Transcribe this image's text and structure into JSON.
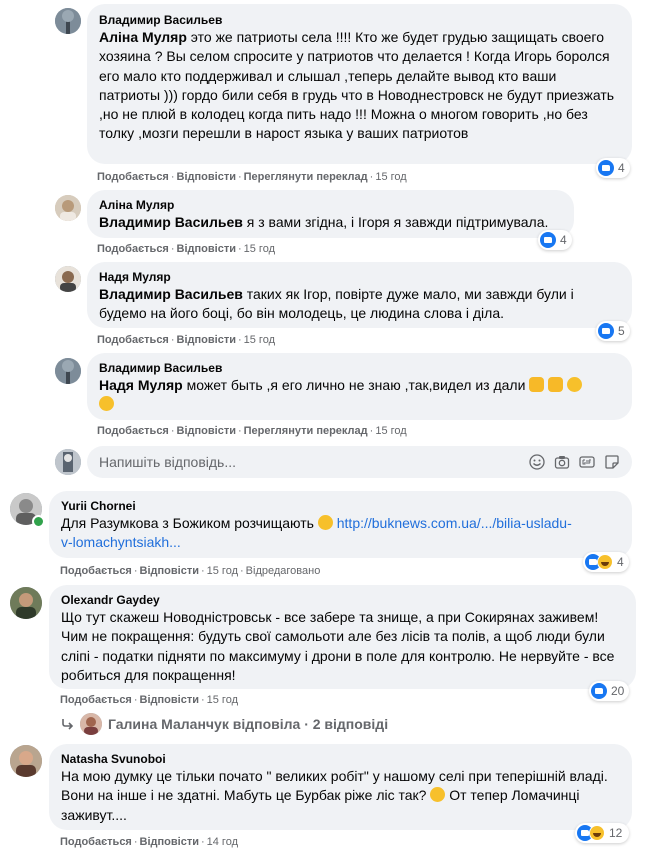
{
  "comments": [
    {
      "author": "Владимир Васильев",
      "mention": "Аліна Муляр",
      "text": " это же патриоты села !!!! Кто же будет грудью защищать своего хозяина ? Вы селом спросите у патриотов что делается ! Когда Игорь боролся его мало кто поддерживал и слышал ,теперь делайте вывод кто ваши патриоты ))) гордо били себя в грудь что в Новоднестровск не будут приезжать ,но не плюй в колодец когда пить надо !!! Можна о многом говорить ,но без толку ,мозги перешли в нарост языка у ваших патриотов",
      "actions": {
        "like": "Подобається",
        "reply": "Відповісти",
        "translate": "Переглянути переклад",
        "time": "15 год"
      },
      "reactions": "4"
    },
    {
      "author": "Аліна Муляр",
      "mention": "Владимир Васильев",
      "text": " я з вами згідна, і Ігоря я завжди підтримувала.",
      "actions": {
        "like": "Подобається",
        "reply": "Відповісти",
        "time": "15 год"
      },
      "reactions": "4"
    },
    {
      "author": "Надя Муляр",
      "mention": "Владимир Васильев",
      "text": " таких як Ігор, повірте дуже мало, ми завжди були і будемо на його боці, бо він молодець, це людина слова і діла.",
      "actions": {
        "like": "Подобається",
        "reply": "Відповісти",
        "time": "15 год"
      },
      "reactions": "5"
    },
    {
      "author": "Владимир Васильев",
      "mention": "Надя Муляр",
      "text": " может быть ,я его лично не знаю ,так,видел из дали",
      "actions": {
        "like": "Подобається",
        "reply": "Відповісти",
        "translate": "Переглянути переклад",
        "time": "15 год"
      }
    }
  ],
  "reply_box": {
    "placeholder": "Напишіть відповідь..."
  },
  "top_comments": [
    {
      "author": "Yurii Chornei",
      "text": "Для Разумкова з Божиком розчищають",
      "link_line1": "http://buknews.com.ua/.../bilia-usladu-",
      "link_line2": "v-lomachyntsiakh...",
      "actions": {
        "like": "Подобається",
        "reply": "Відповісти",
        "time": "15 год",
        "edited": "Відредаговано"
      },
      "reactions": "4"
    },
    {
      "author": "Olexandr Gaydey",
      "text": "Що тут скажеш Новодністровськ - все забере та знище, а при Сокирянах заживем! Чим не покращення: будуть свої самольоти але без лісів та полів, а щоб люди були сліпі - податки підняти по максимуму і дрони в поле для контролю. Не нервуйте - все робиться для покращення!",
      "actions": {
        "like": "Подобається",
        "reply": "Відповісти",
        "time": "15 год"
      },
      "reactions": "20",
      "replies": "Галина Маланчук відповіла · 2 відповіді"
    },
    {
      "author": "Natasha Svunoboi",
      "text": "На мою думку це тільки почато \" великих робіт\" у нашому селі при теперішній владі. Вони на інше і не здатні. Мабуть це Бурбак ріже ліс так?",
      "text_tail": " От тепер Ломачинці заживут....",
      "actions": {
        "like": "Подобається",
        "reply": "Відповісти",
        "time": "14 год"
      },
      "reactions": "12"
    }
  ],
  "icons": [
    "emoji-icon",
    "camera-icon",
    "gif-icon",
    "sticker-icon"
  ],
  "colors": {
    "bubble": "#f0f2f5",
    "link": "#216fdb",
    "like": "#1877f2",
    "meta": "#65676b"
  }
}
